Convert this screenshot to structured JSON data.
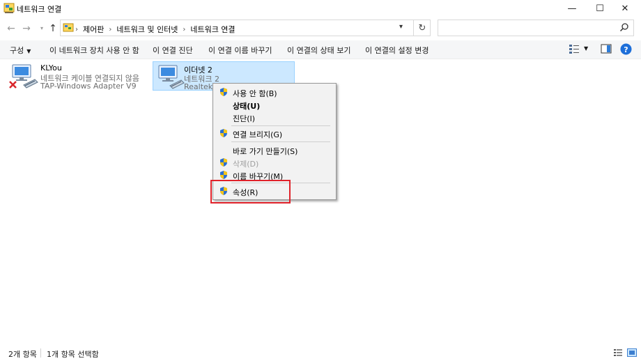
{
  "window": {
    "title": "네트워크 연결",
    "controls": {
      "minimize": "—",
      "maximize": "☐",
      "close": "✕"
    }
  },
  "address": {
    "crumbs": [
      "제어판",
      "네트워크 및 인터넷",
      "네트워크 연결"
    ],
    "refresh_icon": "↻",
    "search_placeholder": ""
  },
  "toolbar": {
    "organize": "구성",
    "actions": [
      "이 네트워크 장치 사용 안 함",
      "이 연결 진단",
      "이 연결 이름 바꾸기",
      "이 연결의 상태 보기",
      "이 연결의 설정 변경"
    ]
  },
  "items": [
    {
      "name": "KLYou",
      "status": "네트워크 케이블 연결되지 않음",
      "adapter": "TAP-Windows Adapter V9",
      "selected": false,
      "disconnected": true
    },
    {
      "name": "이더넷 2",
      "status": "네트워크 2",
      "adapter": "Realtek PCIe GbE Family Controller",
      "selected": true,
      "disconnected": false
    }
  ],
  "context_menu": {
    "items": [
      {
        "label": "사용 안 함(B)",
        "shield": true,
        "bold": false,
        "disabled": false
      },
      {
        "label": "상태(U)",
        "shield": false,
        "bold": true,
        "disabled": false
      },
      {
        "label": "진단(I)",
        "shield": false,
        "bold": false,
        "disabled": false
      },
      {
        "label": "연결 브리지(G)",
        "shield": true,
        "bold": false,
        "disabled": false
      },
      {
        "label": "바로 가기 만들기(S)",
        "shield": false,
        "bold": false,
        "disabled": false
      },
      {
        "label": "삭제(D)",
        "shield": true,
        "bold": false,
        "disabled": true
      },
      {
        "label": "이름 바꾸기(M)",
        "shield": true,
        "bold": false,
        "disabled": false
      },
      {
        "label": "속성(R)",
        "shield": true,
        "bold": false,
        "disabled": false
      }
    ]
  },
  "status": {
    "count": "2개 항목",
    "selected": "1개 항목 선택함"
  },
  "colors": {
    "selection_bg": "#cce8ff",
    "selection_border": "#99d1ff",
    "highlight_box": "#e0222a",
    "help_blue": "#1e6fd9"
  }
}
